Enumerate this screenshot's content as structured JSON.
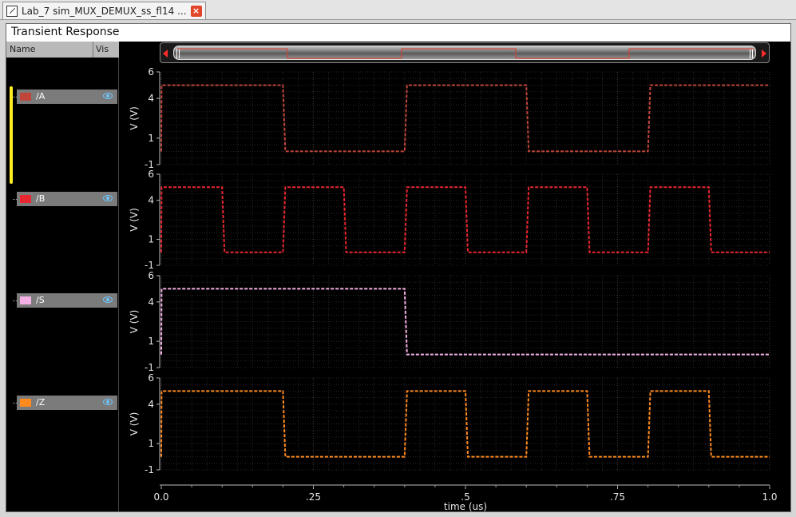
{
  "tab": {
    "title": "Lab_7 sim_MUX_DEMUX_ss_fl14 ...",
    "close_glyph": "×"
  },
  "window": {
    "title": "Transient Response"
  },
  "panel": {
    "col_name": "Name",
    "col_vis": "Vis"
  },
  "colors": {
    "A": "#c0463a",
    "B": "#e8262f",
    "S": "#f4b0e4",
    "Z": "#ff8a1f"
  },
  "chart_data": {
    "type": "line",
    "title": "Transient Response",
    "xlabel": "time (us)",
    "x_ticks": [
      "0.0",
      ".25",
      ".5",
      ".75",
      "1.0"
    ],
    "xlim": [
      0,
      1.0
    ],
    "grid": true,
    "panels": [
      {
        "name": "/A",
        "ylabel": "V (V)",
        "yticks": [
          "6",
          "4",
          "1",
          "-1"
        ],
        "ylim": [
          -1,
          6
        ],
        "color": "#c0463a",
        "x": [
          0,
          0.0005,
          0.2,
          0.204,
          0.4,
          0.404,
          0.6,
          0.604,
          0.8,
          0.804,
          1.0
        ],
        "y": [
          0,
          5,
          5,
          0,
          0,
          5,
          5,
          0,
          0,
          5,
          5
        ]
      },
      {
        "name": "/B",
        "ylabel": "V (V)",
        "yticks": [
          "6",
          "4",
          "1",
          "-1"
        ],
        "ylim": [
          -1,
          6
        ],
        "color": "#e8262f",
        "x": [
          0,
          0.0005,
          0.1,
          0.104,
          0.2,
          0.204,
          0.3,
          0.304,
          0.4,
          0.404,
          0.5,
          0.504,
          0.6,
          0.604,
          0.7,
          0.704,
          0.8,
          0.804,
          0.9,
          0.904,
          1.0
        ],
        "y": [
          0,
          5,
          5,
          0,
          0,
          5,
          5,
          0,
          0,
          5,
          5,
          0,
          0,
          5,
          5,
          0,
          0,
          5,
          5,
          0,
          0
        ]
      },
      {
        "name": "/S",
        "ylabel": "V (V)",
        "yticks": [
          "6",
          "4",
          "1",
          "-1"
        ],
        "ylim": [
          -1,
          6
        ],
        "color": "#f4b0e4",
        "x": [
          0,
          0.0005,
          0.4,
          0.404,
          1.0
        ],
        "y": [
          0,
          5,
          5,
          0,
          0
        ]
      },
      {
        "name": "/Z",
        "ylabel": "V (V)",
        "yticks": [
          "6",
          "4",
          "1",
          "-1"
        ],
        "ylim": [
          -1,
          6
        ],
        "color": "#ff8a1f",
        "x": [
          0,
          0.0005,
          0.2,
          0.204,
          0.4,
          0.404,
          0.5,
          0.504,
          0.6,
          0.604,
          0.7,
          0.704,
          0.8,
          0.804,
          0.9,
          0.904,
          1.0
        ],
        "y": [
          0,
          5,
          5,
          0,
          0,
          5,
          5,
          0,
          0,
          5,
          5,
          0,
          0,
          5,
          5,
          0,
          0
        ]
      }
    ]
  }
}
